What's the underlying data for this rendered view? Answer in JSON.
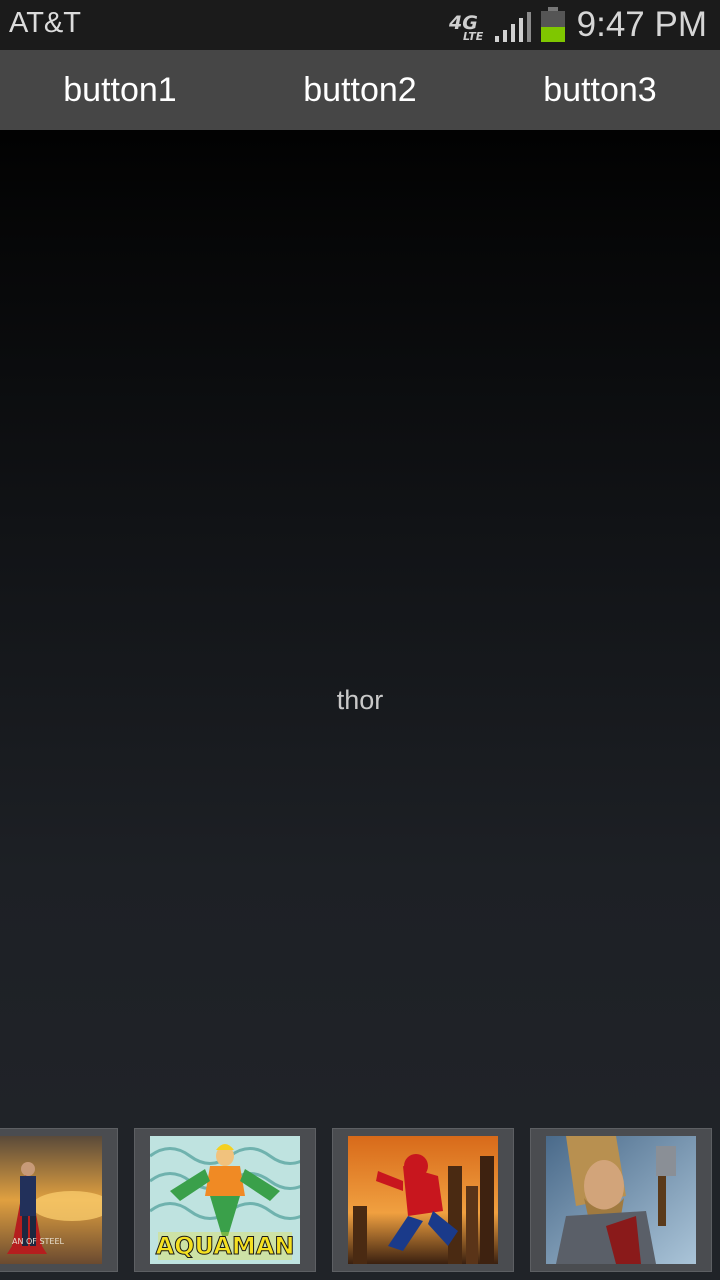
{
  "status_bar": {
    "carrier": "AT&T",
    "network_type": "4G",
    "network_subtype": "LTE",
    "time": "9:47 PM",
    "signal_icon": "signal-strength-icon",
    "battery_icon": "battery-icon",
    "battery_color": "#7fc700"
  },
  "toolbar": {
    "buttons": [
      {
        "label": "button1"
      },
      {
        "label": "button2"
      },
      {
        "label": "button3"
      }
    ]
  },
  "main": {
    "selected_label": "thor"
  },
  "gallery": {
    "items": [
      {
        "name": "superman",
        "caption": "AN OF STEEL"
      },
      {
        "name": "aquaman",
        "caption": "AQUAMAN"
      },
      {
        "name": "spiderman"
      },
      {
        "name": "thor"
      }
    ]
  }
}
